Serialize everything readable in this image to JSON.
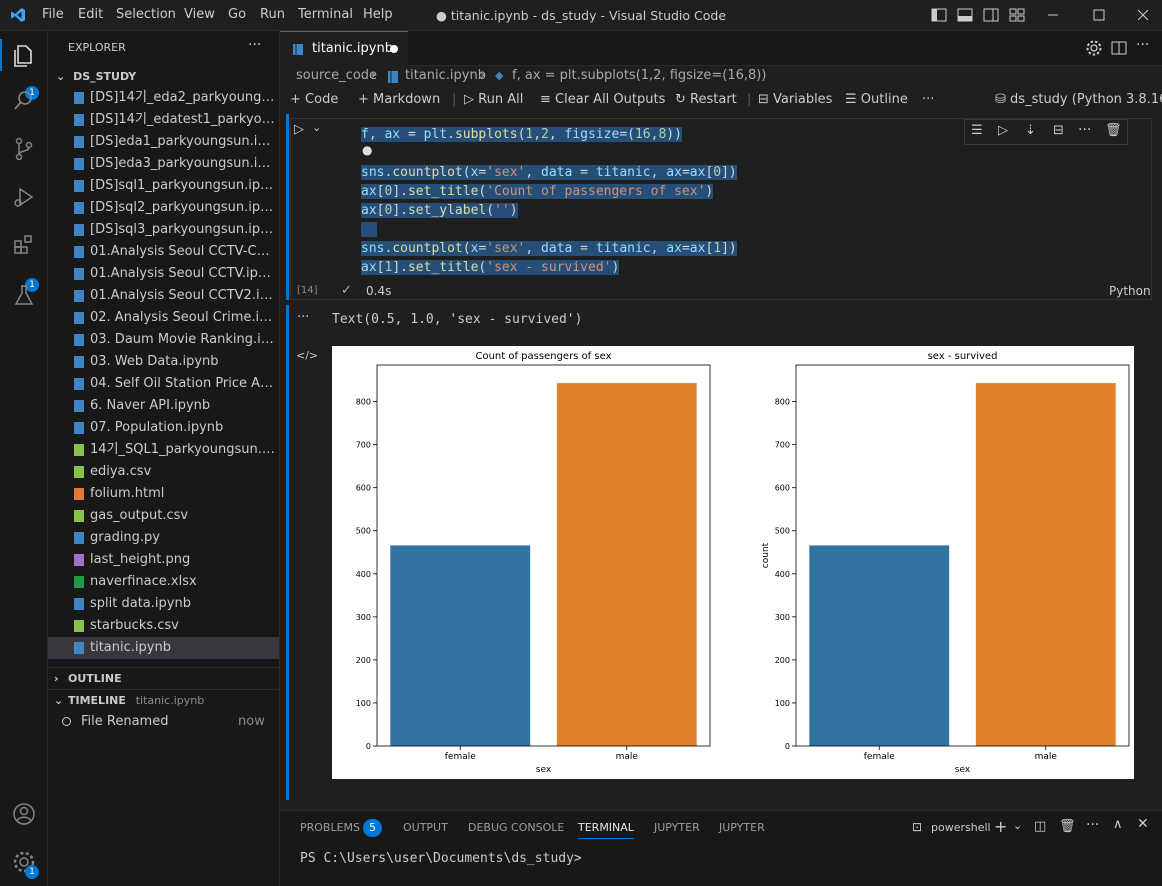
{
  "titlebar": {
    "menus": [
      "File",
      "Edit",
      "Selection",
      "View",
      "Go",
      "Run",
      "Terminal",
      "Help"
    ],
    "title": "● titanic.ipynb - ds_study - Visual Studio Code"
  },
  "activity": {
    "explorer_badge": "1",
    "extensions_badge": "1",
    "settings_badge": "1"
  },
  "sidebar": {
    "header": "EXPLORER",
    "folder": "DS_STUDY",
    "files": [
      {
        "name": "[DS]14기_eda2_parkyoungsun.i...",
        "icon": "notebook"
      },
      {
        "name": "[DS]14기_edatest1_parkyoungs...",
        "icon": "notebook"
      },
      {
        "name": "[DS]eda1_parkyoungsun.ipynb",
        "icon": "notebook"
      },
      {
        "name": "[DS]eda3_parkyoungsun.ipynb",
        "icon": "notebook"
      },
      {
        "name": "[DS]sql1_parkyoungsun.ipynb",
        "icon": "notebook"
      },
      {
        "name": "[DS]sql2_parkyoungsun.ipynb",
        "icon": "notebook"
      },
      {
        "name": "[DS]sql3_parkyoungsun.ipynb",
        "icon": "notebook"
      },
      {
        "name": "01.Analysis Seoul CCTV-Copy1....",
        "icon": "notebook"
      },
      {
        "name": "01.Analysis Seoul CCTV.ipynb",
        "icon": "notebook"
      },
      {
        "name": "01.Analysis Seoul CCTV2.ipynb",
        "icon": "notebook"
      },
      {
        "name": "02. Analysis Seoul Crime.ipynb",
        "icon": "notebook"
      },
      {
        "name": "03. Daum Movie Ranking.ipynb",
        "icon": "notebook"
      },
      {
        "name": "03. Web Data.ipynb",
        "icon": "notebook"
      },
      {
        "name": "04. Self Oil Station Price Analys...",
        "icon": "notebook"
      },
      {
        "name": "6. Naver API.ipynb",
        "icon": "notebook"
      },
      {
        "name": "07. Population.ipynb",
        "icon": "notebook"
      },
      {
        "name": "14기_SQL1_parkyoungsun.csv.c...",
        "icon": "csv"
      },
      {
        "name": "ediya.csv",
        "icon": "csv"
      },
      {
        "name": "folium.html",
        "icon": "html"
      },
      {
        "name": "gas_output.csv",
        "icon": "csv"
      },
      {
        "name": "grading.py",
        "icon": "python"
      },
      {
        "name": "last_height.png",
        "icon": "image"
      },
      {
        "name": "naverfinace.xlsx",
        "icon": "excel"
      },
      {
        "name": "split data.ipynb",
        "icon": "notebook"
      },
      {
        "name": "starbucks.csv",
        "icon": "csv"
      },
      {
        "name": "titanic.ipynb",
        "icon": "notebook"
      }
    ],
    "outline": "OUTLINE",
    "timeline": "TIMELINE",
    "timeline_file": "titanic.ipynb",
    "timeline_item": "File Renamed",
    "timeline_when": "now"
  },
  "editor": {
    "tab": "titanic.ipynb",
    "breadcrumb": [
      "source_code",
      "titanic.ipynb",
      "f, ax = plt.subplots(1,2, figsize=(16,8))"
    ],
    "toolbar": {
      "code": "Code",
      "markdown": "Markdown",
      "run_all": "Run All",
      "clear": "Clear All Outputs",
      "restart": "Restart",
      "variables": "Variables",
      "outline": "Outline",
      "kernel": "ds_study (Python 3.8.16)"
    },
    "cell": {
      "exec_count": "[14]",
      "duration": "0.4s",
      "language": "Python"
    },
    "output_text": "Text(0.5, 1.0, 'sex - survived')"
  },
  "chart_data": [
    {
      "type": "bar",
      "title": "Count of passengers of sex",
      "categories": [
        "female",
        "male"
      ],
      "values": [
        466,
        843
      ],
      "xlabel": "sex",
      "ylabel": "",
      "ylim": [
        0,
        885
      ],
      "yticks": [
        0,
        100,
        200,
        300,
        400,
        500,
        600,
        700,
        800
      ],
      "colors": [
        "#3274a1",
        "#e1812c"
      ]
    },
    {
      "type": "bar",
      "title": "sex - survived",
      "categories": [
        "female",
        "male"
      ],
      "values": [
        466,
        843
      ],
      "xlabel": "sex",
      "ylabel": "count",
      "ylim": [
        0,
        885
      ],
      "yticks": [
        0,
        100,
        200,
        300,
        400,
        500,
        600,
        700,
        800
      ],
      "colors": [
        "#3274a1",
        "#e1812c"
      ]
    }
  ],
  "panel": {
    "tabs": [
      "PROBLEMS",
      "OUTPUT",
      "DEBUG CONSOLE",
      "TERMINAL",
      "JUPYTER",
      "JUPYTER"
    ],
    "problems_count": "5",
    "shell": "powershell",
    "prompt": "PS C:\\Users\\user\\Documents\\ds_study>"
  },
  "colors": {
    "accent": "#0078d4",
    "female_bar": "#3274a1",
    "male_bar": "#e1812c"
  }
}
